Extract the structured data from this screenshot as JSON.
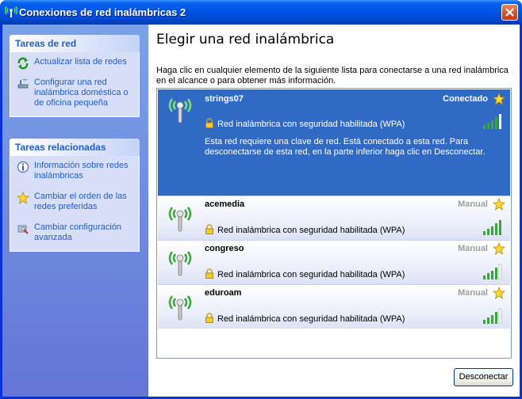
{
  "window": {
    "title": "Conexiones de red inalámbricas 2"
  },
  "sidebar": {
    "network_tasks": {
      "header": "Tareas de red",
      "items": [
        {
          "label": "Actualizar lista de redes",
          "icon": "refresh-icon"
        },
        {
          "label": "Configurar una red inalámbrica doméstica o de oficina pequeña",
          "icon": "setup-wizard-icon"
        }
      ]
    },
    "related_tasks": {
      "header": "Tareas relacionadas",
      "items": [
        {
          "label": "Información sobre redes inalámbricas",
          "icon": "info-icon"
        },
        {
          "label": "Cambiar el orden de las redes preferidas",
          "icon": "star-icon"
        },
        {
          "label": "Cambiar configuración avanzada",
          "icon": "settings-icon"
        }
      ]
    }
  },
  "main": {
    "title": "Elegir una red inalámbrica",
    "description": "Haga clic en cualquier elemento de la siguiente lista para conectarse a una red inalámbrica en el alcance o para obtener más información.",
    "networks": [
      {
        "name": "strings07",
        "status": "Conectado",
        "security": "Red inalámbrica con seguridad habilitada (WPA)",
        "signal_bars": 4,
        "selected": true,
        "detail": "Esta red requiere una clave de red. Está conectado a esta red. Para desconectarse de esta red, en la parte inferior haga clic en Desconectar."
      },
      {
        "name": "acemedia",
        "status": "Manual",
        "security": "Red inalámbrica con seguridad habilitada (WPA)",
        "signal_bars": 5
      },
      {
        "name": "congreso",
        "status": "Manual",
        "security": "Red inalámbrica con seguridad habilitada (WPA)",
        "signal_bars": 4
      },
      {
        "name": "eduroam",
        "status": "Manual",
        "security": "Red inalámbrica con seguridad habilitada (WPA)",
        "signal_bars": 4
      }
    ],
    "disconnect_label": "Desconectar"
  },
  "colors": {
    "titlebar": "#0055e5",
    "selection": "#316ac5",
    "link": "#215dc6",
    "signal": "#3aa63a"
  }
}
